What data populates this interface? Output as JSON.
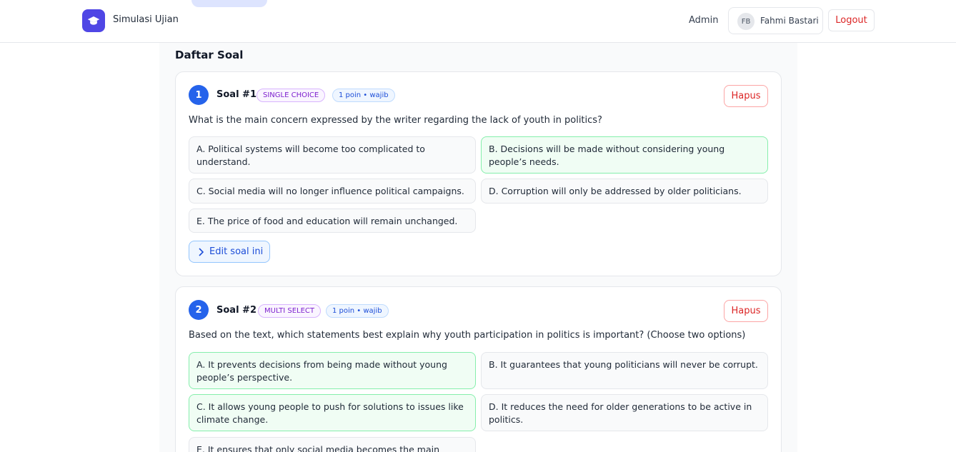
{
  "header": {
    "app_title": "Simulasi Ujian",
    "nav_admin": "Admin",
    "user_initials": "FB",
    "user_name": "Fahmi Bastari",
    "logout_label": "Logout"
  },
  "section_title": "Daftar Soal",
  "questions": [
    {
      "number": "1",
      "title": "Soal #1",
      "type_badge": "SINGLE CHOICE",
      "points_badge": "1 poin • wajib",
      "delete_label": "Hapus",
      "text": "What is the main concern expressed by the writer regarding the lack of youth in politics?",
      "options": [
        {
          "text": "A. Political systems will become too complicated to understand.",
          "correct": false
        },
        {
          "text": "B. Decisions will be made without considering young people’s needs.",
          "correct": true
        },
        {
          "text": "C. Social media will no longer influence political campaigns.",
          "correct": false
        },
        {
          "text": "D. Corruption will only be addressed by older politicians.",
          "correct": false
        },
        {
          "text": "E. The price of food and education will remain unchanged.",
          "correct": false
        }
      ],
      "edit_label": "Edit soal ini"
    },
    {
      "number": "2",
      "title": "Soal #2",
      "type_badge": "MULTI SELECT",
      "points_badge": "1 poin • wajib",
      "delete_label": "Hapus",
      "text": "Based on the text, which statements best explain why youth participation in politics is important? (Choose two options)",
      "options": [
        {
          "text": "A. It prevents decisions from being made without young people’s perspective.",
          "correct": true
        },
        {
          "text": "B. It guarantees that young politicians will never be corrupt.",
          "correct": false
        },
        {
          "text": "C. It allows young people to push for solutions to issues like climate change.",
          "correct": true
        },
        {
          "text": "D. It reduces the need for older generations to be active in politics.",
          "correct": false
        },
        {
          "text": "E. It ensures that only social media becomes the main political",
          "correct": false
        }
      ]
    }
  ],
  "colors": {
    "brand": "#4f46e5",
    "number_circle": "#2563eb",
    "correct_bg": "#f0fdf4",
    "correct_border": "#86efac",
    "danger": "#dc2626"
  },
  "icons": {
    "logo": "graduation-cap-icon",
    "edit": "chevron-right-icon"
  }
}
